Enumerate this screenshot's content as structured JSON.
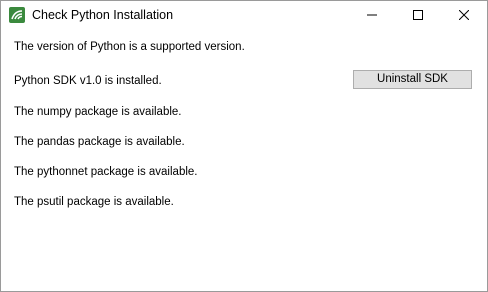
{
  "window": {
    "title": "Check Python Installation"
  },
  "controls": {
    "minimize_icon": "minimize-icon",
    "maximize_icon": "maximize-icon",
    "close_icon": "close-icon"
  },
  "messages": {
    "version": "The version of Python is a supported version.",
    "sdk": "Python SDK v1.0 is installed.",
    "numpy": "The numpy package is available.",
    "pandas": "The pandas package is available.",
    "pythonnet": "The pythonnet package is available.",
    "psutil": "The psutil package is available."
  },
  "actions": {
    "uninstall_label": "Uninstall SDK"
  },
  "colors": {
    "icon_green": "#3b8a3e",
    "button_face": "#e1e1e1",
    "button_border": "#adadad"
  }
}
